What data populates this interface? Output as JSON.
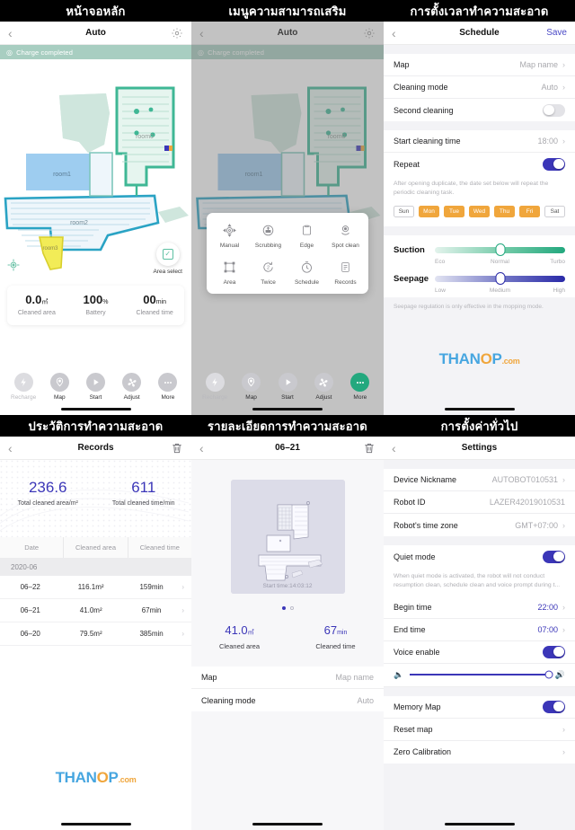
{
  "panels": {
    "home": {
      "caption": "หน้าจอหลัก",
      "nav": {
        "title": "Auto",
        "back_icon": "chevron-left-icon",
        "gear_icon": "gear-icon"
      },
      "status": "Charge completed",
      "map": {
        "rooms": [
          "room0",
          "room1",
          "room2",
          "room3"
        ],
        "area_select_label": "Area select"
      },
      "stats": [
        {
          "value": "0.0",
          "unit": "㎡",
          "label": "Cleaned area"
        },
        {
          "value": "100",
          "unit": "%",
          "label": "Battery"
        },
        {
          "value": "00",
          "unit": "min",
          "label": "Cleaned time"
        }
      ],
      "toolbar": [
        {
          "label": "Recharge",
          "icon": "bolt-icon",
          "state": "muted"
        },
        {
          "label": "Map",
          "icon": "pin-icon",
          "state": "normal"
        },
        {
          "label": "Start",
          "icon": "play-icon",
          "state": "normal"
        },
        {
          "label": "Adjust",
          "icon": "fan-icon",
          "state": "normal"
        },
        {
          "label": "More",
          "icon": "dots-icon",
          "state": "normal"
        }
      ]
    },
    "more_menu": {
      "caption": "เมนูความสามารถเสริม",
      "nav": {
        "title": "Auto",
        "back_icon": "chevron-left-icon",
        "gear_icon": "gear-icon"
      },
      "status": "Charge completed",
      "items": [
        {
          "label": "Manual",
          "icon": "dpad-icon"
        },
        {
          "label": "Scrubbing",
          "icon": "mop-icon"
        },
        {
          "label": "Edge",
          "icon": "clipboard-icon"
        },
        {
          "label": "Spot clean",
          "icon": "spot-pin-icon"
        },
        {
          "label": "Area",
          "icon": "square-corners-icon"
        },
        {
          "label": "Twice",
          "icon": "repeat-two-icon"
        },
        {
          "label": "Schedule",
          "icon": "clock-icon"
        },
        {
          "label": "Records",
          "icon": "list-doc-icon"
        }
      ],
      "toolbar": [
        {
          "label": "Recharge",
          "icon": "bolt-icon",
          "state": "muted"
        },
        {
          "label": "Map",
          "icon": "pin-icon",
          "state": "normal"
        },
        {
          "label": "Start",
          "icon": "play-icon",
          "state": "normal"
        },
        {
          "label": "Adjust",
          "icon": "fan-icon",
          "state": "normal"
        },
        {
          "label": "More",
          "icon": "dots-icon",
          "state": "active"
        }
      ]
    },
    "schedule": {
      "caption": "การตั้งเวลาทำความสะอาด",
      "nav": {
        "title": "Schedule",
        "back_icon": "chevron-left-icon",
        "save_label": "Save"
      },
      "rows_top": [
        {
          "label": "Map",
          "value": "Map name",
          "chevron": true
        },
        {
          "label": "Cleaning mode",
          "value": "Auto",
          "chevron": true
        },
        {
          "label": "Second cleaning",
          "toggle": false
        }
      ],
      "rows_mid": [
        {
          "label": "Start cleaning time",
          "value": "18:00",
          "chevron": true
        },
        {
          "label": "Repeat",
          "toggle": true
        }
      ],
      "repeat_note": "After opening duplicate, the date set below will repeat the periodic cleaning task.",
      "days": [
        {
          "label": "Sun",
          "selected": false
        },
        {
          "label": "Mon",
          "selected": true
        },
        {
          "label": "Tue",
          "selected": true
        },
        {
          "label": "Wed",
          "selected": true
        },
        {
          "label": "Thu",
          "selected": true
        },
        {
          "label": "Fri",
          "selected": true
        },
        {
          "label": "Sat",
          "selected": false
        }
      ],
      "suction": {
        "name": "Suction",
        "ticks": [
          "Eco",
          "Normal",
          "Turbo"
        ],
        "value": "Normal"
      },
      "seepage": {
        "name": "Seepage",
        "ticks": [
          "Low",
          "Medium",
          "High"
        ],
        "value": "Medium"
      },
      "footnote": "Seepage regulation is only effective in the mopping mode.",
      "watermark": {
        "t1": "THAN",
        "o": "O",
        "t2": "P",
        "com": ".com"
      }
    },
    "records": {
      "caption": "ประวัติการทำความสะอาด",
      "nav": {
        "title": "Records",
        "back_icon": "chevron-left-icon",
        "trash_icon": "trash-icon"
      },
      "totals": [
        {
          "n": "236.6",
          "t": "Total cleaned area/m²"
        },
        {
          "n": "611",
          "t": "Total cleaned time/min"
        }
      ],
      "columns": [
        "Date",
        "Cleaned area",
        "Cleaned time"
      ],
      "month": "2020-06",
      "rows": [
        {
          "date": "06–22",
          "area": "116.1m²",
          "time": "159min"
        },
        {
          "date": "06–21",
          "area": "41.0m²",
          "time": "67min"
        },
        {
          "date": "06–20",
          "area": "79.5m²",
          "time": "385min"
        }
      ],
      "watermark": {
        "t1": "THAN",
        "o": "O",
        "t2": "P",
        "com": ".com"
      }
    },
    "detail": {
      "caption": "รายละเอียดการทำความสะอาด",
      "nav": {
        "title": "06–21",
        "back_icon": "chevron-left-icon",
        "trash_icon": "trash-icon"
      },
      "start_time": "Start time:14:03:12",
      "stats": [
        {
          "value": "41.0",
          "unit": "㎡",
          "label": "Cleaned area"
        },
        {
          "value": "67",
          "unit": "min",
          "label": "Cleaned time"
        }
      ],
      "rows": [
        {
          "label": "Map",
          "value": "Map name"
        },
        {
          "label": "Cleaning mode",
          "value": "Auto"
        }
      ]
    },
    "settings": {
      "caption": "การตั้งค่าทั่วไป",
      "nav": {
        "title": "Settings",
        "back_icon": "chevron-left-icon"
      },
      "group1": [
        {
          "label": "Device Nickname",
          "value": "AUTOBOT010531",
          "chevron": true
        },
        {
          "label": "Robot ID",
          "value": "LAZER42019010531",
          "chevron": false
        },
        {
          "label": "Robot's time zone",
          "value": "GMT+07:00",
          "chevron": true
        }
      ],
      "quiet": {
        "label": "Quiet mode",
        "toggle": true
      },
      "quiet_note": "When quiet mode is activated, the robot will not conduct resumption clean, schedule clean and voice prompt during t...",
      "group2": [
        {
          "label": "Begin time",
          "value": "22:00",
          "chevron": true
        },
        {
          "label": "End time",
          "value": "07:00",
          "chevron": true
        },
        {
          "label": "Voice enable",
          "toggle": true
        }
      ],
      "volume": {
        "min_icon": "speaker-low-icon",
        "max_icon": "speaker-high-icon",
        "value": 100
      },
      "group3": [
        {
          "label": "Memory Map",
          "toggle": true
        },
        {
          "label": "Reset map",
          "chevron": true
        },
        {
          "label": "Zero Calibration",
          "chevron": true
        }
      ]
    }
  },
  "colors": {
    "accent_green": "#23a87e",
    "accent_indigo": "#3b36b8",
    "orange": "#f0a63c",
    "status_green": "#a8cec1"
  }
}
